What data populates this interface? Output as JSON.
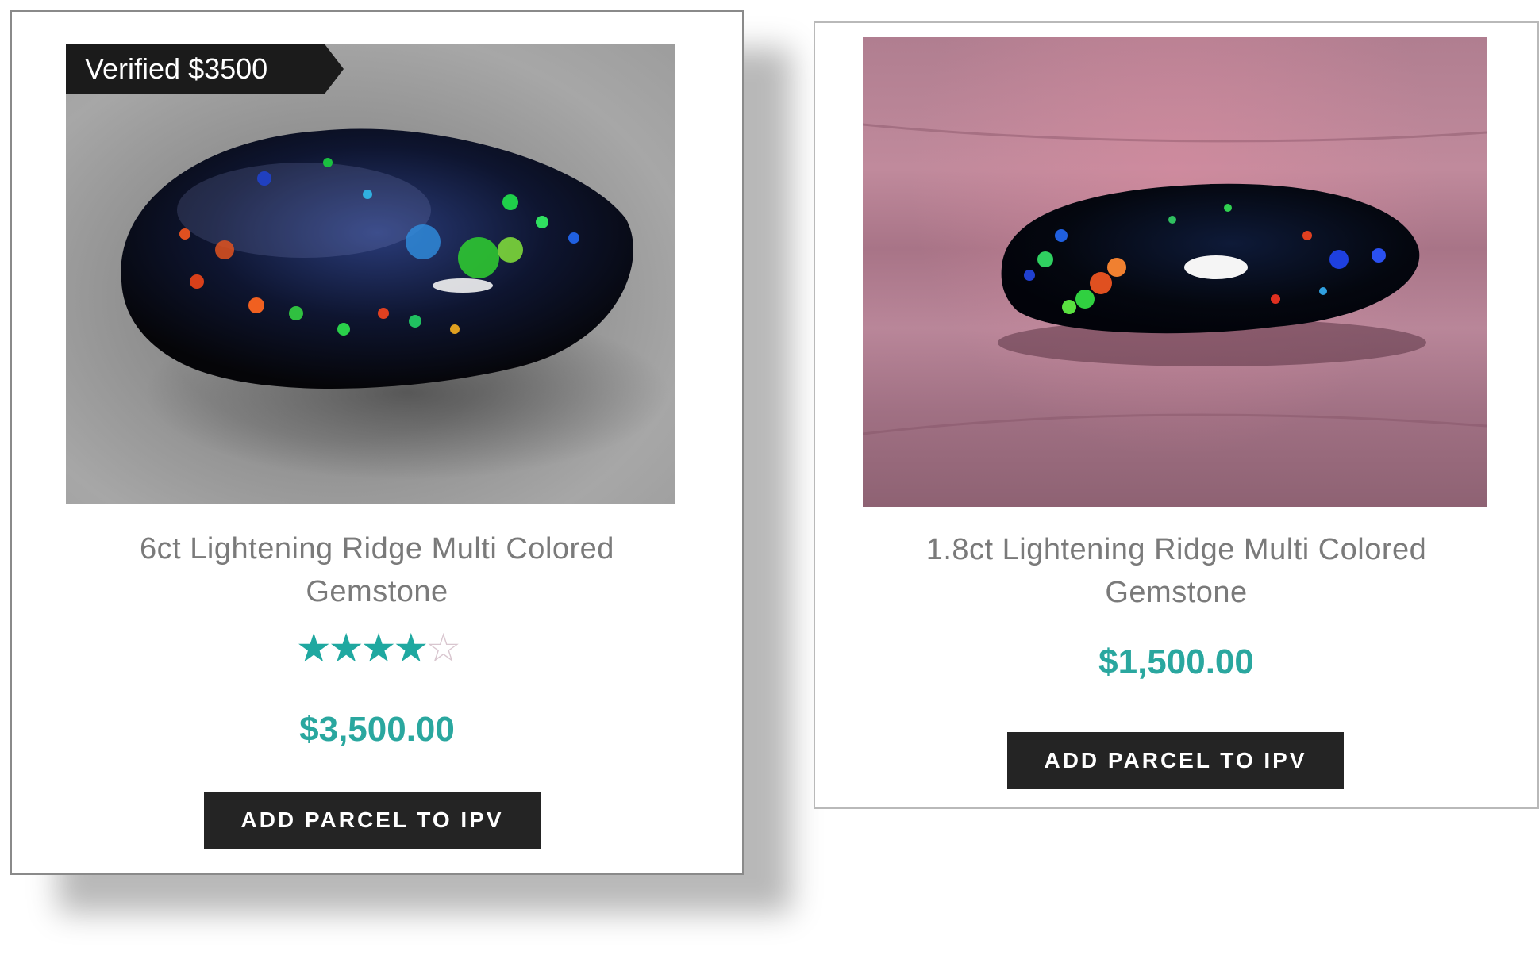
{
  "products": [
    {
      "badge": "Verified $3500",
      "title": "6ct Lightening Ridge Multi Colored Gemstone",
      "rating": 4.2,
      "rating_max": 5,
      "price": "$3,500.00",
      "button_label": "ADD PARCEL TO IPV"
    },
    {
      "title": "1.8ct Lightening Ridge Multi Colored Gemstone",
      "price": "$1,500.00",
      "button_label": "ADD PARCEL TO IPV"
    }
  ],
  "colors": {
    "accent": "#2aa79f",
    "button_bg": "#242424",
    "badge_bg": "#1b1b1b",
    "title_text": "#7a7a7a"
  },
  "icons": [
    "star-filled-icon",
    "star-empty-icon"
  ]
}
